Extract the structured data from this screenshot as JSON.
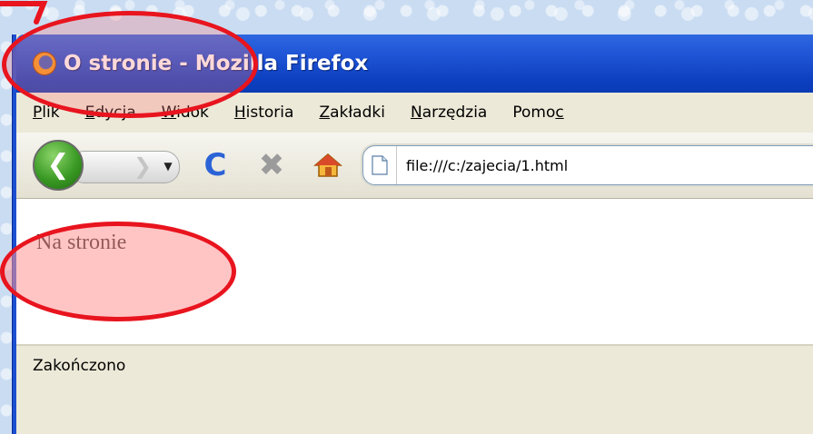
{
  "window": {
    "title": "O stronie - Mozilla Firefox"
  },
  "menu": {
    "items": [
      {
        "prefix": "",
        "underline": "P",
        "rest": "lik"
      },
      {
        "prefix": "",
        "underline": "E",
        "rest": "dycja"
      },
      {
        "prefix": "",
        "underline": "W",
        "rest": "idok"
      },
      {
        "prefix": "",
        "underline": "H",
        "rest": "istoria"
      },
      {
        "prefix": "",
        "underline": "Z",
        "rest": "akładki"
      },
      {
        "prefix": "",
        "underline": "N",
        "rest": "arzędzia"
      },
      {
        "prefix": "Pomo",
        "underline": "c",
        "rest": ""
      }
    ]
  },
  "nav": {
    "url": "file:///c:/zajecia/1.html"
  },
  "page": {
    "text": "Na stronie"
  },
  "status": {
    "text": "Zakończono"
  },
  "colors": {
    "annotation": "#e8141e",
    "titlebar": "#1f55d6"
  },
  "icons": [
    "firefox-icon",
    "back-icon",
    "forward-icon",
    "dropdown-icon",
    "reload-icon",
    "stop-icon",
    "home-icon",
    "page-icon"
  ]
}
